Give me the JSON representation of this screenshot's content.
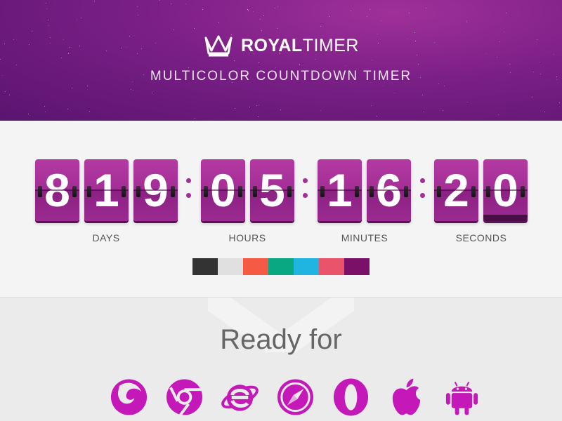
{
  "header": {
    "brand_bold": "ROYAL",
    "brand_light": "TIMER",
    "tagline": "MULTICOLOR COUNTDOWN TIMER"
  },
  "timer": {
    "days": [
      "8",
      "1",
      "9"
    ],
    "hours": [
      "0",
      "5"
    ],
    "minutes": [
      "1",
      "6"
    ],
    "seconds": [
      "2",
      "0"
    ],
    "labels": {
      "days": "DAYS",
      "hours": "HOURS",
      "minutes": "MINUTES",
      "seconds": "SECONDS"
    }
  },
  "colors": {
    "accent": "#a32e95",
    "swatches": [
      "#333333",
      "#e0e0e0",
      "#f45a44",
      "#0aa882",
      "#1fb5e0",
      "#e9546b",
      "#7a1068"
    ]
  },
  "ready": {
    "title": "Ready for",
    "icons": [
      "firefox-icon",
      "chrome-icon",
      "internet-explorer-icon",
      "safari-icon",
      "opera-icon",
      "apple-icon",
      "android-icon"
    ]
  }
}
